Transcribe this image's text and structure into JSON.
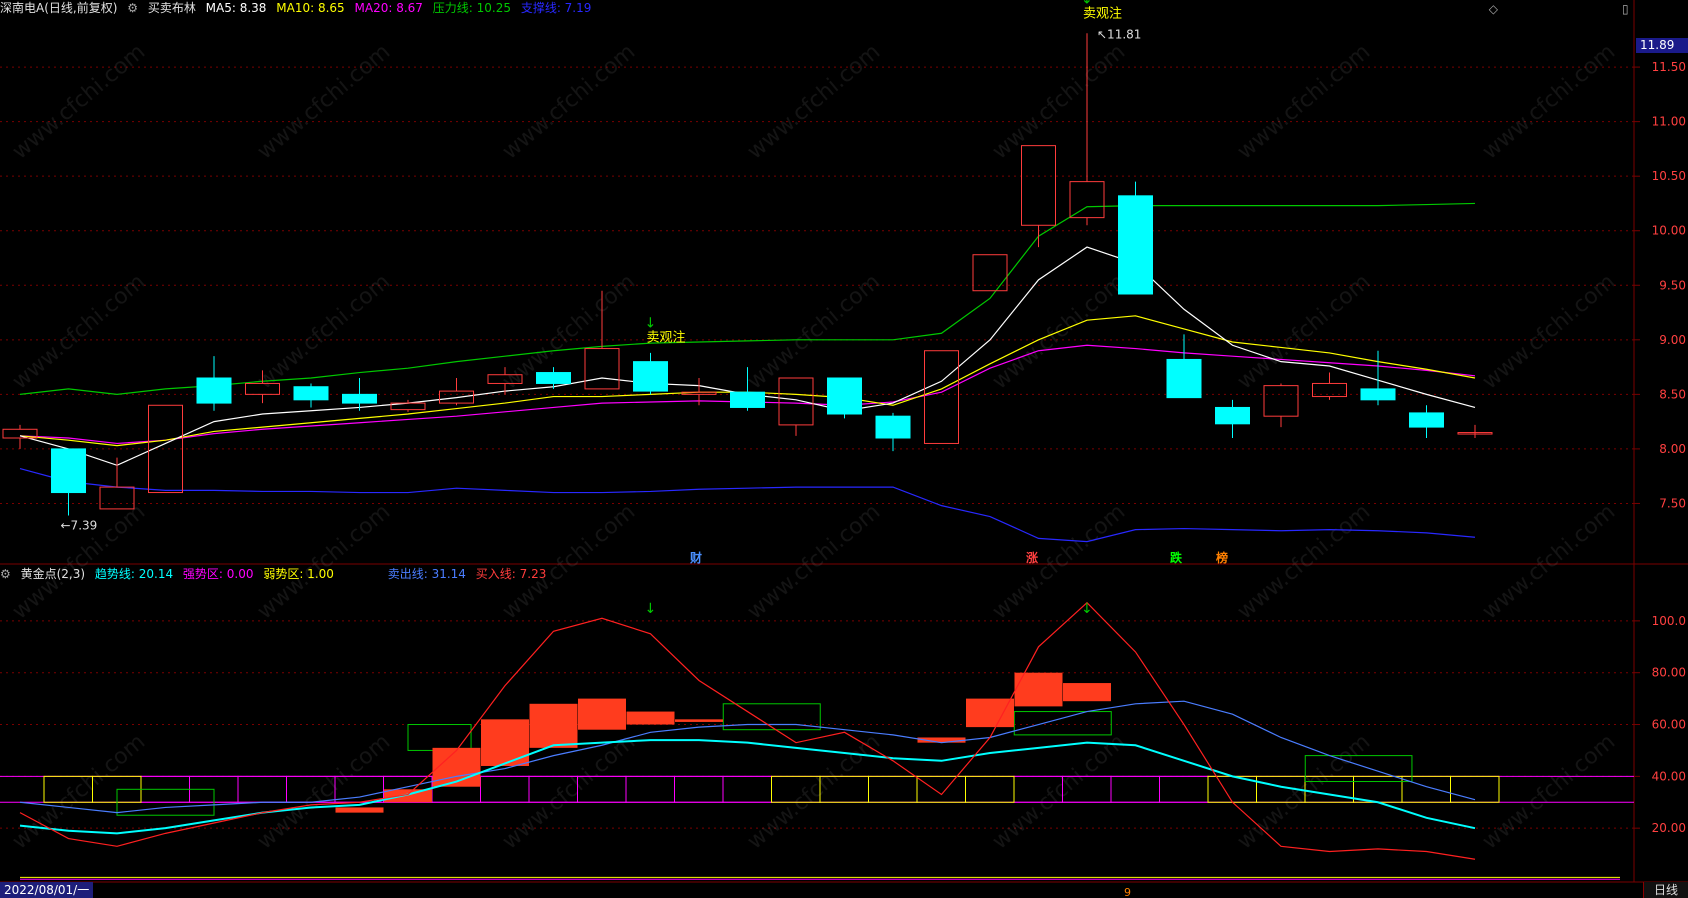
{
  "colors": {
    "bg": "#000000",
    "up": "#ff3c3c",
    "down": "#00ffff",
    "grid": "#7a0000",
    "ma5": "#ffffff",
    "ma10": "#ffff00",
    "ma20": "#ff00ff",
    "pressure": "#00c800",
    "support": "#2828ff",
    "scale_text": "#ff4040"
  },
  "top_panel": {
    "title": "深南电A(日线,前复权)",
    "indicator": "买卖布林",
    "ma5_label": "MA5: 8.38",
    "ma10_label": "MA10: 8.65",
    "ma20_label": "MA20: 8.67",
    "pressure_label": "压力线: 10.25",
    "support_label": "支撑线: 7.19",
    "price_tag": "11.89",
    "y_ticks": [
      "11.50",
      "11.00",
      "10.50",
      "10.00",
      "9.50",
      "9.00",
      "8.50",
      "8.00",
      "7.50"
    ],
    "high_label": "11.81",
    "low_label": "7.39",
    "signal1": "卖观注",
    "signal2": "卖观注",
    "markers": [
      "财",
      "涨",
      "跌",
      "榜"
    ]
  },
  "bottom_panel": {
    "indicator": "黄金点(2,3)",
    "trend_label": "趋势线: 20.14",
    "strong_label": "强势区: 0.00",
    "weak_label": "弱势区: 1.00",
    "sell_label": "卖出线: 31.14",
    "buy_label": "买入线: 7.23",
    "y_ticks": [
      "100.0",
      "80.00",
      "60.00",
      "40.00",
      "20.00"
    ],
    "date": "2022/08/01/一",
    "period": "日线",
    "cursor_mark": "9"
  },
  "watermark": "www.cfchi.com",
  "chart_data": {
    "type": "candlestick",
    "price_ylim": [
      7.0,
      11.95
    ],
    "candles": [
      {
        "o": 8.1,
        "c": 8.18,
        "h": 8.22,
        "l": 8.0
      },
      {
        "o": 8.0,
        "c": 7.6,
        "h": 8.0,
        "l": 7.39
      },
      {
        "o": 7.45,
        "c": 7.65,
        "h": 7.92,
        "l": 7.45
      },
      {
        "o": 7.6,
        "c": 8.4,
        "h": 8.4,
        "l": 7.6
      },
      {
        "o": 8.65,
        "c": 8.42,
        "h": 8.85,
        "l": 8.35
      },
      {
        "o": 8.5,
        "c": 8.6,
        "h": 8.72,
        "l": 8.42
      },
      {
        "o": 8.57,
        "c": 8.45,
        "h": 8.6,
        "l": 8.38
      },
      {
        "o": 8.5,
        "c": 8.42,
        "h": 8.65,
        "l": 8.35
      },
      {
        "o": 8.36,
        "c": 8.42,
        "h": 8.45,
        "l": 8.34
      },
      {
        "o": 8.42,
        "c": 8.53,
        "h": 8.65,
        "l": 8.4
      },
      {
        "o": 8.6,
        "c": 8.68,
        "h": 8.75,
        "l": 8.5
      },
      {
        "o": 8.7,
        "c": 8.6,
        "h": 8.75,
        "l": 8.55
      },
      {
        "o": 8.55,
        "c": 8.92,
        "h": 9.45,
        "l": 8.55
      },
      {
        "o": 8.8,
        "c": 8.53,
        "h": 8.88,
        "l": 8.5
      },
      {
        "o": 8.5,
        "c": 8.52,
        "h": 8.65,
        "l": 8.4
      },
      {
        "o": 8.52,
        "c": 8.38,
        "h": 8.75,
        "l": 8.35
      },
      {
        "o": 8.22,
        "c": 8.65,
        "h": 8.65,
        "l": 8.12
      },
      {
        "o": 8.65,
        "c": 8.32,
        "h": 8.65,
        "l": 8.28
      },
      {
        "o": 8.3,
        "c": 8.1,
        "h": 8.33,
        "l": 7.98
      },
      {
        "o": 8.05,
        "c": 8.9,
        "h": 8.9,
        "l": 8.05
      },
      {
        "o": 9.45,
        "c": 9.78,
        "h": 9.78,
        "l": 9.45
      },
      {
        "o": 10.05,
        "c": 10.78,
        "h": 10.78,
        "l": 9.85
      },
      {
        "o": 10.12,
        "c": 10.45,
        "h": 11.81,
        "l": 10.05
      },
      {
        "o": 10.32,
        "c": 9.42,
        "h": 10.45,
        "l": 9.42
      },
      {
        "o": 8.82,
        "c": 8.47,
        "h": 9.05,
        "l": 8.47
      },
      {
        "o": 8.38,
        "c": 8.23,
        "h": 8.45,
        "l": 8.1
      },
      {
        "o": 8.3,
        "c": 8.58,
        "h": 8.6,
        "l": 8.2
      },
      {
        "o": 8.48,
        "c": 8.6,
        "h": 8.7,
        "l": 8.45
      },
      {
        "o": 8.55,
        "c": 8.45,
        "h": 8.9,
        "l": 8.4
      },
      {
        "o": 8.33,
        "c": 8.2,
        "h": 8.4,
        "l": 8.1
      },
      {
        "o": 8.15,
        "c": 8.15,
        "h": 8.22,
        "l": 8.1
      }
    ],
    "ma5": [
      8.12,
      8.0,
      7.85,
      8.05,
      8.25,
      8.32,
      8.35,
      8.38,
      8.42,
      8.47,
      8.53,
      8.57,
      8.65,
      8.6,
      8.58,
      8.5,
      8.45,
      8.35,
      8.42,
      8.62,
      9.0,
      9.55,
      9.85,
      9.7,
      9.28,
      8.95,
      8.8,
      8.76,
      8.63,
      8.5,
      8.38
    ],
    "ma10": [
      8.12,
      8.08,
      8.03,
      8.08,
      8.16,
      8.2,
      8.24,
      8.28,
      8.32,
      8.37,
      8.42,
      8.48,
      8.48,
      8.5,
      8.52,
      8.52,
      8.5,
      8.47,
      8.4,
      8.55,
      8.78,
      9.0,
      9.18,
      9.22,
      9.1,
      8.98,
      8.93,
      8.88,
      8.8,
      8.73,
      8.65
    ],
    "ma20": [
      8.12,
      8.1,
      8.05,
      8.08,
      8.14,
      8.18,
      8.21,
      8.24,
      8.27,
      8.3,
      8.34,
      8.38,
      8.42,
      8.43,
      8.44,
      8.43,
      8.42,
      8.4,
      8.43,
      8.52,
      8.74,
      8.9,
      8.95,
      8.92,
      8.88,
      8.85,
      8.82,
      8.79,
      8.76,
      8.72,
      8.67
    ],
    "pressure": [
      8.5,
      8.55,
      8.5,
      8.55,
      8.58,
      8.62,
      8.65,
      8.7,
      8.74,
      8.8,
      8.85,
      8.9,
      8.94,
      8.97,
      8.98,
      8.99,
      9.0,
      9.0,
      9.0,
      9.06,
      9.38,
      9.95,
      10.22,
      10.23,
      10.23,
      10.23,
      10.23,
      10.23,
      10.23,
      10.24,
      10.25
    ],
    "support": [
      7.82,
      7.7,
      7.65,
      7.62,
      7.62,
      7.61,
      7.61,
      7.6,
      7.6,
      7.64,
      7.62,
      7.6,
      7.6,
      7.61,
      7.63,
      7.64,
      7.65,
      7.65,
      7.65,
      7.48,
      7.38,
      7.18,
      7.15,
      7.26,
      7.27,
      7.26,
      7.25,
      7.26,
      7.25,
      7.23,
      7.19
    ],
    "osc_ylim": [
      0,
      115
    ],
    "osc_red": [
      26,
      16,
      13,
      18,
      22,
      26,
      29,
      30,
      33,
      50,
      75,
      96,
      101,
      95,
      77,
      65,
      53,
      57,
      46,
      33,
      55,
      90,
      107,
      88,
      60,
      30,
      13,
      11,
      12,
      11,
      8
    ],
    "osc_blue": [
      30,
      28,
      26,
      28,
      29,
      30,
      30,
      32,
      36,
      40,
      43,
      48,
      52,
      57,
      59,
      60,
      60,
      58,
      56,
      53,
      55,
      60,
      65,
      68,
      69,
      64,
      55,
      48,
      42,
      36,
      31
    ],
    "osc_cyan": [
      21,
      19,
      18,
      20,
      23,
      26,
      28,
      29,
      33,
      38,
      45,
      52,
      53,
      54,
      54,
      53,
      51,
      49,
      47,
      46,
      49,
      51,
      53,
      52,
      46,
      40,
      36,
      33,
      30,
      24,
      20
    ],
    "osc_bars": [
      {
        "i": 7,
        "lo": 26,
        "hi": 28
      },
      {
        "i": 8,
        "lo": 30,
        "hi": 35
      },
      {
        "i": 9,
        "lo": 36,
        "hi": 51
      },
      {
        "i": 10,
        "lo": 44,
        "hi": 62
      },
      {
        "i": 11,
        "lo": 51,
        "hi": 68
      },
      {
        "i": 12,
        "lo": 58,
        "hi": 70
      },
      {
        "i": 13,
        "lo": 60,
        "hi": 65
      },
      {
        "i": 14,
        "lo": 61,
        "hi": 62
      },
      {
        "i": 19,
        "lo": 53,
        "hi": 55
      },
      {
        "i": 20,
        "lo": 59,
        "hi": 70
      },
      {
        "i": 21,
        "lo": 67,
        "hi": 80
      },
      {
        "i": 22,
        "lo": 69,
        "hi": 76
      }
    ],
    "osc_green_boxes": [
      {
        "a": 2,
        "b": 4,
        "lo": 25,
        "hi": 35
      },
      {
        "a": 8,
        "b": 9.3,
        "lo": 50,
        "hi": 60
      },
      {
        "a": 14.5,
        "b": 16.5,
        "lo": 58,
        "hi": 68
      },
      {
        "a": 20.5,
        "b": 22.5,
        "lo": 56,
        "hi": 65
      },
      {
        "a": 26.5,
        "b": 28.7,
        "lo": 38,
        "hi": 48
      }
    ],
    "osc_yellow_boxes": [
      0,
      1,
      15,
      16,
      17,
      18,
      19,
      24,
      25,
      26,
      27,
      28,
      29
    ],
    "osc_magenta_boxes": [
      2,
      3,
      4,
      5,
      6,
      7,
      8,
      9,
      10,
      11,
      12,
      13,
      14,
      20,
      21,
      22,
      23
    ]
  }
}
